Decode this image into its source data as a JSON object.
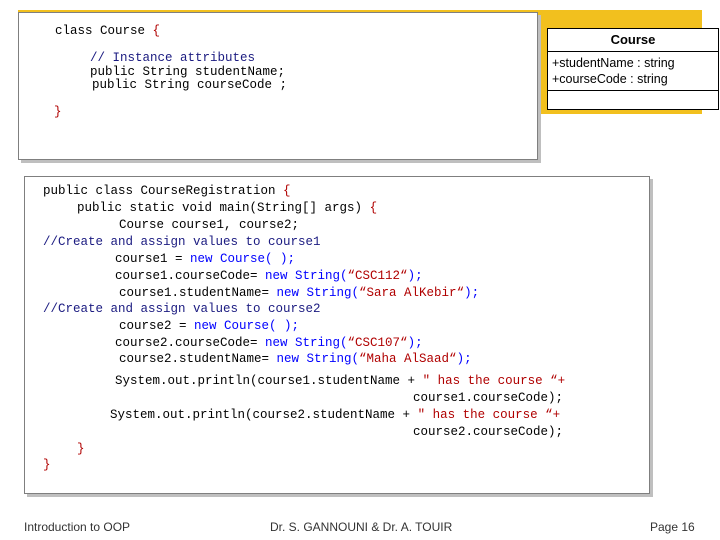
{
  "slide": {
    "course_class": {
      "line1_a": "class Course ",
      "line1_b": "{",
      "comment": "// Instance attributes",
      "attr1": "public String studentName;",
      "attr2": "public String courseCode ;",
      "close": "}"
    },
    "uml": {
      "class_name": "Course",
      "attr1": "+studentName : string",
      "attr2": "+courseCode : string"
    },
    "registration": {
      "l1a": "public class CourseRegistration ",
      "l1b": "{",
      "l2a": "public static void main(String[] args) ",
      "l2b": "{",
      "l3": "Course course1, course2;",
      "c1": "//Create and assign values to course1",
      "l4a": "course1 = ",
      "l4b": "new Course( );",
      "l5a": "course1.courseCode= ",
      "l5b": "new String(",
      "l5c": "“CSC112“",
      "l5d": ");",
      "l6a": "course1.studentName= ",
      "l6b": "new String(",
      "l6c": "“Sara AlKebir“",
      "l6d": ");",
      "c2": "//Create and assign values to course2",
      "l7a": "course2 = ",
      "l7b": "new Course( );",
      "l8a": "course2.courseCode= ",
      "l8b": "new String(",
      "l8c": "“CSC107“",
      "l8d": ");",
      "l9a": "course2.studentName= ",
      "l9b": "new String(",
      "l9c": "“Maha AlSaad“",
      "l9d": ");",
      "p1a": "System.out.println(course1.studentName + ",
      "p1b": "\" has the course “+",
      "p1c": "course1.courseCode);",
      "p2a": "System.out.println(course2.studentName + ",
      "p2b": "\" has the course “+",
      "p2c": "course2.courseCode);",
      "close_inner": "}",
      "close_outer": "}"
    },
    "footer": {
      "left": "Introduction to OOP",
      "center": "Dr. S. GANNOUNI & Dr.  A. TOUIR",
      "right": "Page 16"
    }
  }
}
